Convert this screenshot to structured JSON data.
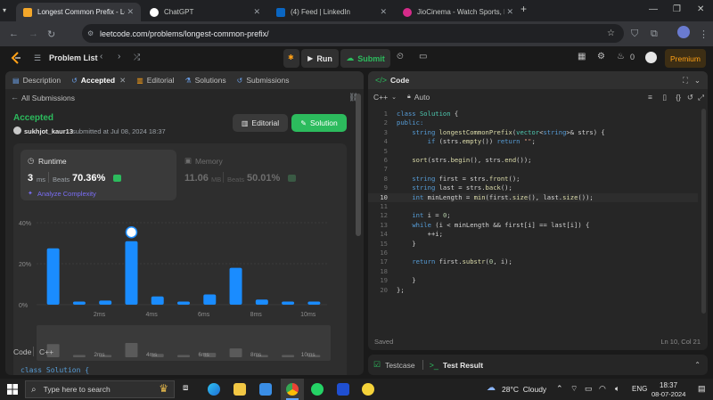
{
  "browser": {
    "tabs": [
      {
        "title": "Longest Common Prefix - Leet",
        "active": true,
        "color": "#f4a72a"
      },
      {
        "title": "ChatGPT",
        "active": false,
        "color": "#ffffff"
      },
      {
        "title": "(4) Feed | LinkedIn",
        "active": false,
        "color": "#0a66c2"
      },
      {
        "title": "JioCinema - Watch Sports, Mov",
        "active": false,
        "color": "#d62b8a"
      }
    ],
    "new_tab": "+",
    "url": "leetcode.com/problems/longest-common-prefix/"
  },
  "leetcode": {
    "problem_list": "Problem List",
    "run": "Run",
    "submit": "Submit",
    "streak": "0",
    "premium": "Premium"
  },
  "left_panel": {
    "tabs": [
      "Description",
      "Accepted",
      "Editorial",
      "Solutions",
      "Submissions"
    ],
    "all_submissions": "All Submissions",
    "status": "Accepted",
    "user": "sukhjot_kaur13",
    "submitted_text": "submitted at Jul 08, 2024 18:37",
    "editorial_btn": "Editorial",
    "solution_btn": "Solution",
    "runtime": {
      "label": "Runtime",
      "value": "3",
      "unit": "ms",
      "beats_label": "Beats",
      "beats_value": "70.36%"
    },
    "memory": {
      "label": "Memory",
      "value": "11.06",
      "unit": "MB",
      "beats_label": "Beats",
      "beats_value": "50.01%"
    },
    "analyze": "Analyze Complexity",
    "lang_row": {
      "code": "Code",
      "lang": "C++"
    },
    "code_preview": "class Solution {"
  },
  "chart_data": {
    "type": "bar",
    "yticks": [
      "40%",
      "20%",
      "0%"
    ],
    "ylim": [
      0,
      40
    ],
    "xticks": [
      "2ms",
      "4ms",
      "6ms",
      "8ms",
      "10ms"
    ],
    "values": [
      27.5,
      1.5,
      2,
      31,
      4,
      1.5,
      5,
      18,
      2.5,
      1.5,
      1.5
    ],
    "highlight_index": 3,
    "mini_values": [
      12,
      2,
      2,
      13,
      3,
      2,
      4,
      8,
      2,
      2,
      2
    ]
  },
  "editor": {
    "title": "Code",
    "lang": "C++",
    "mode": "Auto",
    "lines": [
      [
        {
          "t": "class ",
          "c": "kw"
        },
        {
          "t": "Solution",
          "c": "ty"
        },
        {
          "t": " {",
          "c": "tx"
        }
      ],
      [
        {
          "t": "public:",
          "c": "kw"
        }
      ],
      [
        {
          "t": "    ",
          "c": "tx"
        },
        {
          "t": "string ",
          "c": "kw"
        },
        {
          "t": "longestCommonPrefix",
          "c": "fn"
        },
        {
          "t": "(",
          "c": "tx"
        },
        {
          "t": "vector",
          "c": "ty"
        },
        {
          "t": "<",
          "c": "tx"
        },
        {
          "t": "string",
          "c": "kw"
        },
        {
          "t": ">& strs) {",
          "c": "tx"
        }
      ],
      [
        {
          "t": "        ",
          "c": "tx"
        },
        {
          "t": "if",
          "c": "kw"
        },
        {
          "t": " (strs.",
          "c": "tx"
        },
        {
          "t": "empty",
          "c": "fn"
        },
        {
          "t": "()) ",
          "c": "tx"
        },
        {
          "t": "return",
          "c": "kw"
        },
        {
          "t": " ",
          "c": "tx"
        },
        {
          "t": "\"\"",
          "c": "st"
        },
        {
          "t": ";",
          "c": "tx"
        }
      ],
      [],
      [
        {
          "t": "    ",
          "c": "tx"
        },
        {
          "t": "sort",
          "c": "fn"
        },
        {
          "t": "(strs.",
          "c": "tx"
        },
        {
          "t": "begin",
          "c": "fn"
        },
        {
          "t": "(), strs.",
          "c": "tx"
        },
        {
          "t": "end",
          "c": "fn"
        },
        {
          "t": "());",
          "c": "tx"
        }
      ],
      [],
      [
        {
          "t": "    ",
          "c": "tx"
        },
        {
          "t": "string ",
          "c": "kw"
        },
        {
          "t": "first = strs.",
          "c": "tx"
        },
        {
          "t": "front",
          "c": "fn"
        },
        {
          "t": "();",
          "c": "tx"
        }
      ],
      [
        {
          "t": "    ",
          "c": "tx"
        },
        {
          "t": "string ",
          "c": "kw"
        },
        {
          "t": "last = strs.",
          "c": "tx"
        },
        {
          "t": "back",
          "c": "fn"
        },
        {
          "t": "();",
          "c": "tx"
        }
      ],
      [
        {
          "t": "    ",
          "c": "tx"
        },
        {
          "t": "int ",
          "c": "kw"
        },
        {
          "t": "minLength = ",
          "c": "tx"
        },
        {
          "t": "min",
          "c": "fn"
        },
        {
          "t": "(first.",
          "c": "tx"
        },
        {
          "t": "size",
          "c": "fn"
        },
        {
          "t": "(), last.",
          "c": "tx"
        },
        {
          "t": "size",
          "c": "fn"
        },
        {
          "t": "());",
          "c": "tx"
        }
      ],
      [],
      [
        {
          "t": "    ",
          "c": "tx"
        },
        {
          "t": "int ",
          "c": "kw"
        },
        {
          "t": "i = ",
          "c": "tx"
        },
        {
          "t": "0",
          "c": "nm"
        },
        {
          "t": ";",
          "c": "tx"
        }
      ],
      [
        {
          "t": "    ",
          "c": "tx"
        },
        {
          "t": "while",
          "c": "kw"
        },
        {
          "t": " (i < minLength && first[i] == last[i]) {",
          "c": "tx"
        }
      ],
      [
        {
          "t": "        ++i;",
          "c": "tx"
        }
      ],
      [
        {
          "t": "    }",
          "c": "tx"
        }
      ],
      [],
      [
        {
          "t": "    ",
          "c": "tx"
        },
        {
          "t": "return",
          "c": "kw"
        },
        {
          "t": " first.",
          "c": "tx"
        },
        {
          "t": "substr",
          "c": "fn"
        },
        {
          "t": "(",
          "c": "tx"
        },
        {
          "t": "0",
          "c": "nm"
        },
        {
          "t": ", i);",
          "c": "tx"
        }
      ],
      [],
      [
        {
          "t": "    }",
          "c": "tx"
        }
      ],
      [
        {
          "t": "};",
          "c": "tx"
        }
      ]
    ],
    "current_line": 10,
    "saved": "Saved",
    "cursor": "Ln 10, Col 21"
  },
  "bottom_tabs": {
    "testcase": "Testcase",
    "test_result": "Test Result"
  },
  "taskbar": {
    "search": "Type here to search",
    "weather": "28°C  Cloudy",
    "lang": "ENG",
    "time": "18:37",
    "date": "08-07-2024"
  }
}
